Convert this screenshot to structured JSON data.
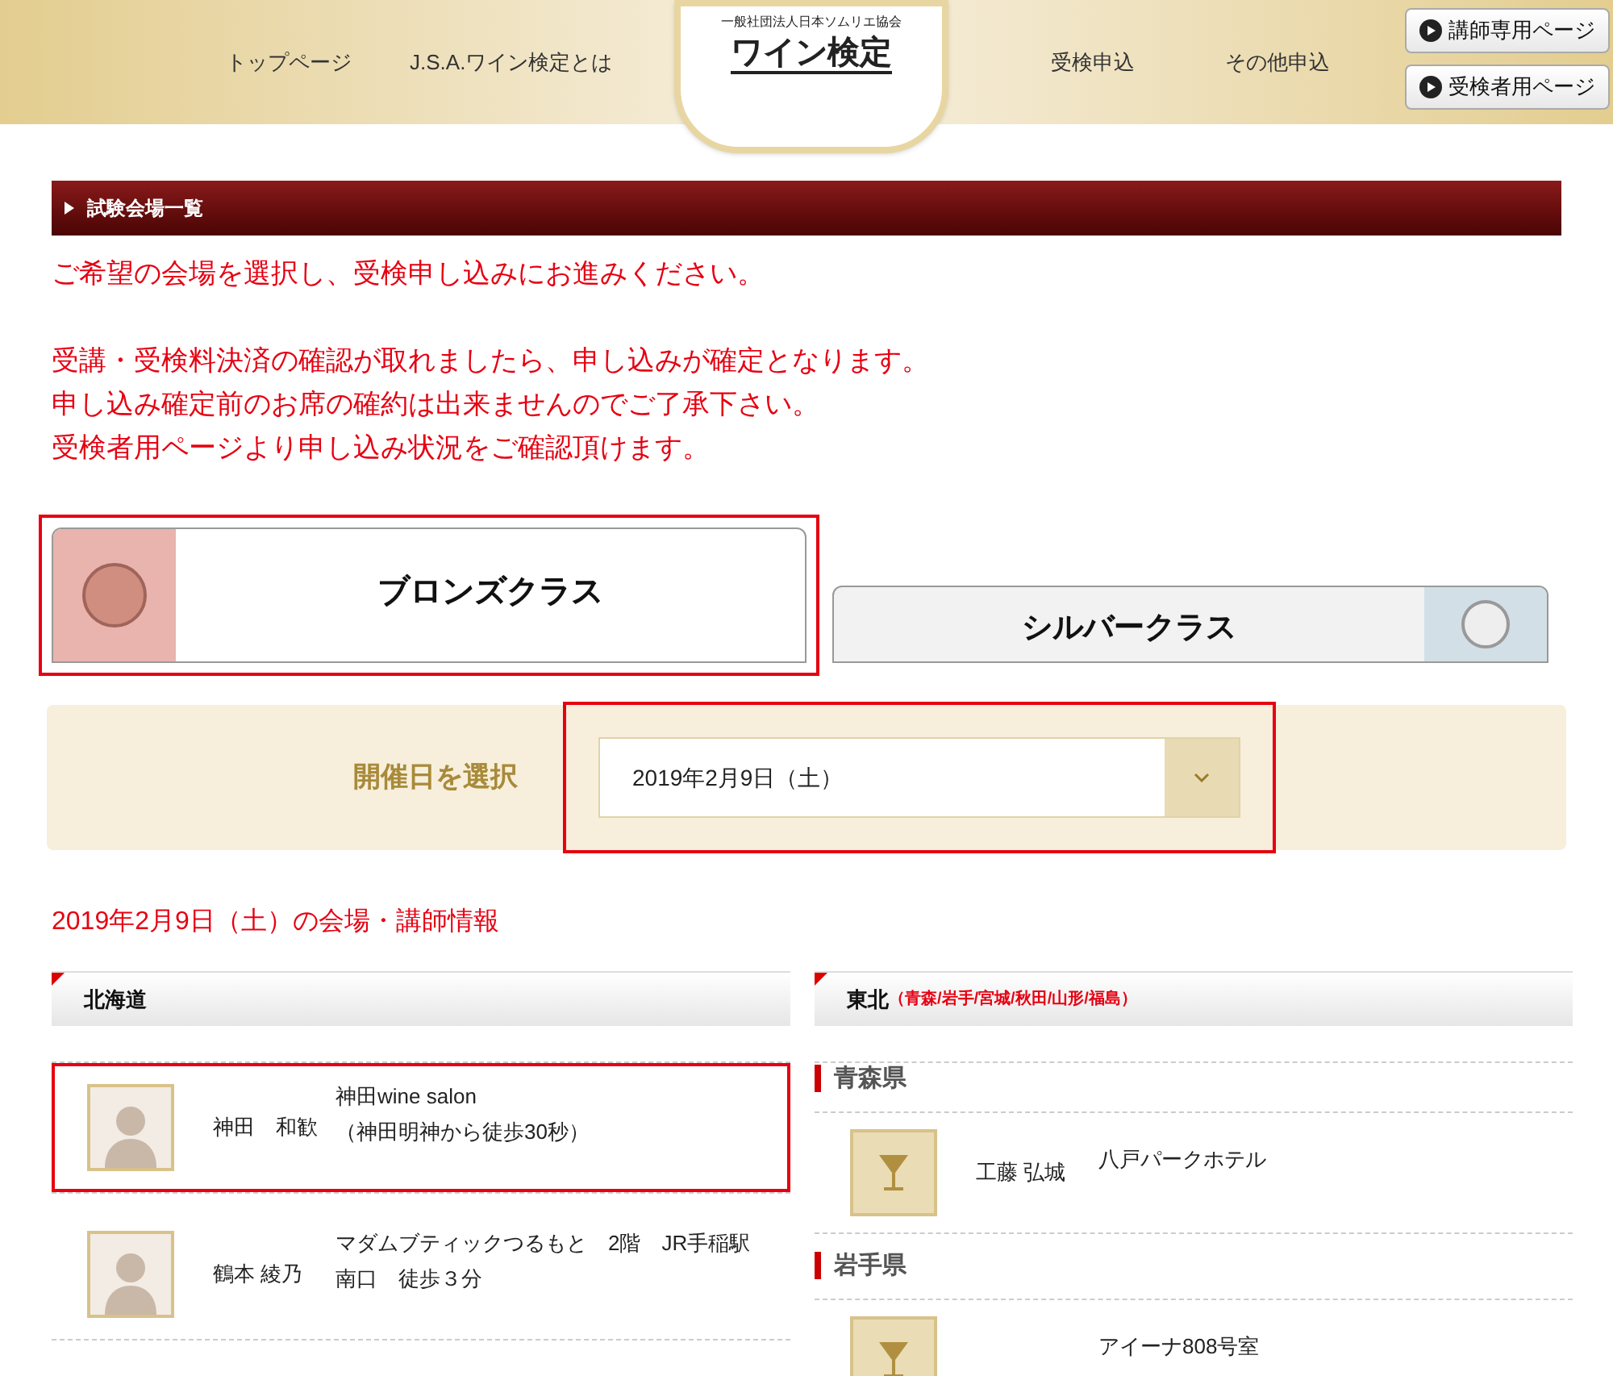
{
  "header": {
    "nav_left": [
      "トップページ",
      "J.S.A.ワイン検定とは"
    ],
    "logo": {
      "org": "一般社団法人日本ソムリエ協会",
      "title": "ワイン検定"
    },
    "nav_right": [
      "受検申込",
      "その他申込"
    ],
    "buttons": [
      "講師専用ページ",
      "受検者用ページ"
    ]
  },
  "section_bar": {
    "title": "試験会場一覧"
  },
  "notice": [
    [
      "ご希望の会場を選択し、受検申し込みにお進みください。"
    ],
    [
      "受講・受検料決済の確認が取れましたら、申し込みが確定となります。",
      "申し込み確定前のお席の確約は出来ませんのでご了承下さい。",
      "受検者用ページより申し込み状況をご確認頂けます。"
    ]
  ],
  "tabs": [
    {
      "label": "ブロンズクラス",
      "selected": true,
      "highlighted": true,
      "color": "#e8b4ad"
    },
    {
      "label": "シルバークラス",
      "selected": false,
      "highlighted": false,
      "color": "#d3dfe6"
    }
  ],
  "date_select": {
    "label": "開催日を選択",
    "value": "2019年2月9日（土）",
    "highlighted": true
  },
  "venue_heading": "2019年2月9日（土）の会場・講師情報",
  "columns": [
    {
      "region": "北海道",
      "blocks": [
        {
          "kind": "person_entry",
          "name": "神田　和歓",
          "venue": [
            "神田wine salon",
            "（神田明神から徒歩30秒）"
          ],
          "highlighted": true
        },
        {
          "kind": "person_entry",
          "name": "鶴本 綾乃",
          "venue": [
            "マダムブティックつるもと　2階　JR手稲駅",
            "南口　徒歩３分"
          ],
          "highlighted": false
        }
      ]
    },
    {
      "region": "東北",
      "note": "（青森/岩手/宮城/秋田/山形/福島）",
      "blocks": [
        {
          "kind": "prefecture",
          "label": "青森県"
        },
        {
          "kind": "glass_entry",
          "name": "工藤 弘城",
          "venue": [
            "八戸パークホテル"
          ],
          "highlighted": false
        },
        {
          "kind": "prefecture",
          "label": "岩手県"
        },
        {
          "kind": "glass_entry",
          "venue": [
            "アイーナ808号室"
          ],
          "highlighted": false
        }
      ]
    }
  ]
}
